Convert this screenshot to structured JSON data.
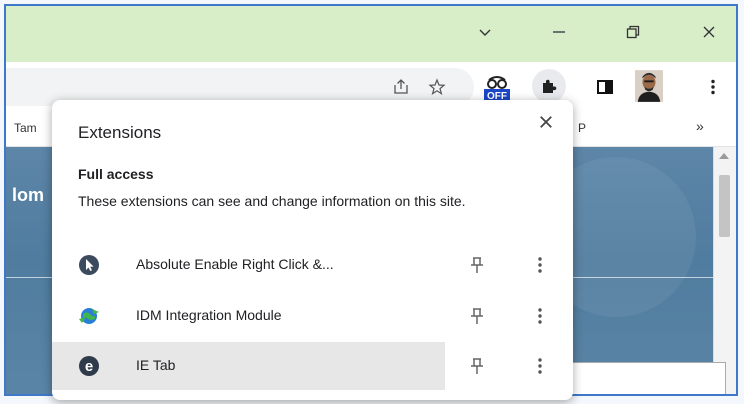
{
  "bookmarks": {
    "left_label": "Tam",
    "right_label": "»",
    "partial_label": "P"
  },
  "page": {
    "partial_heading": "lom"
  },
  "extensions_popup": {
    "title": "Extensions",
    "section_title": "Full access",
    "section_description": "These extensions can see and change information on this site.",
    "items": [
      {
        "name": "Absolute Enable Right Click &...",
        "icon": "cursor-icon"
      },
      {
        "name": "IDM Integration Module",
        "icon": "globe-icon"
      },
      {
        "name": "IE Tab",
        "icon": "ie-icon"
      }
    ]
  },
  "toolbar": {
    "badge_text": "OFF"
  },
  "colors": {
    "titlebar": "#d7eec8",
    "frame_border": "#3f78c8",
    "content_bg": "#5d86a8",
    "badge": "#1a47c7"
  }
}
